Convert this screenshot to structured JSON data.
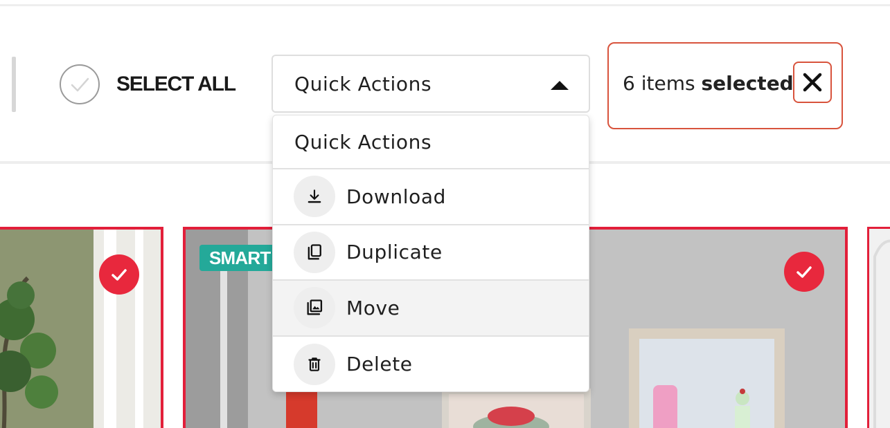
{
  "toolbar": {
    "select_all_label": "SELECT ALL",
    "quick_actions": {
      "selected_value": "Quick Actions",
      "menu_header": "Quick Actions",
      "items": [
        {
          "label": "Download",
          "icon": "download-icon"
        },
        {
          "label": "Duplicate",
          "icon": "duplicate-icon"
        },
        {
          "label": "Move",
          "icon": "move-to-album-icon"
        },
        {
          "label": "Delete",
          "icon": "trash-icon"
        }
      ],
      "hovered_item": "Move"
    },
    "selection": {
      "count_text": "6 items",
      "suffix_text": "selected",
      "close_icon": "close-icon"
    }
  },
  "gallery": {
    "cards": [
      {
        "selected": true,
        "badge": null
      },
      {
        "selected": true,
        "badge": "SMART"
      },
      {
        "selected": false,
        "badge": null
      }
    ]
  },
  "colors": {
    "selection_red": "#e21f3a",
    "check_badge": "#e8283d",
    "smart_badge": "#24a999",
    "highlight_outline": "#d8533c"
  }
}
